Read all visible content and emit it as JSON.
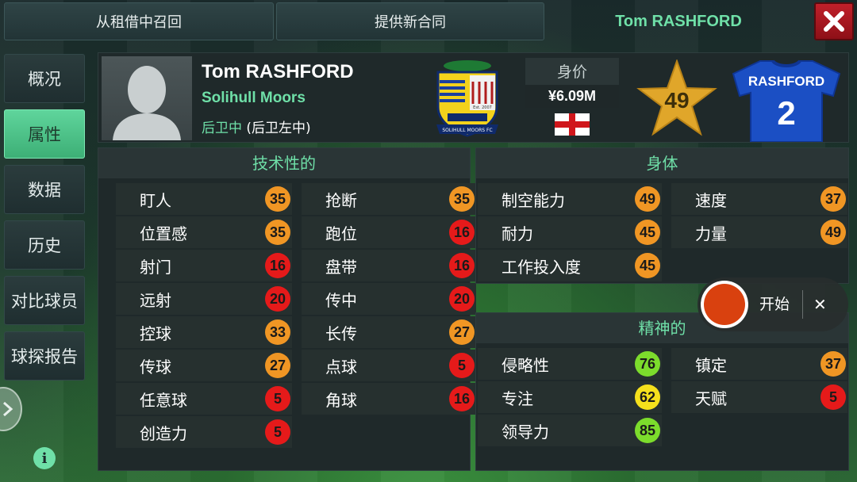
{
  "top": {
    "recall_loan": "从租借中召回",
    "offer_contract": "提供新合同",
    "title": "Tom RASHFORD",
    "close_label": "✕"
  },
  "sidebar": {
    "items": [
      {
        "label": "概况"
      },
      {
        "label": "属性"
      },
      {
        "label": "数据"
      },
      {
        "label": "历史"
      },
      {
        "label": "对比球员"
      },
      {
        "label": "球探报告"
      }
    ],
    "active_index": 1,
    "info_icon": "i"
  },
  "player": {
    "name": "Tom RASHFORD",
    "club": "Solihull Moors",
    "position_primary": "后卫中",
    "position_secondary": "(后卫左中)",
    "value_label": "身价",
    "value": "¥6.09M",
    "rating": "49",
    "shirt_name": "RASHFORD",
    "shirt_number": "2",
    "crest_name": "SOLIHULL MOORS FC",
    "crest_est": "Est. 2007"
  },
  "technical": {
    "title": "技术性的",
    "left": [
      {
        "label": "盯人",
        "value": "35",
        "level": "orange"
      },
      {
        "label": "位置感",
        "value": "35",
        "level": "orange"
      },
      {
        "label": "射门",
        "value": "16",
        "level": "red"
      },
      {
        "label": "远射",
        "value": "20",
        "level": "red"
      },
      {
        "label": "控球",
        "value": "33",
        "level": "orange"
      },
      {
        "label": "传球",
        "value": "27",
        "level": "orange"
      },
      {
        "label": "任意球",
        "value": "5",
        "level": "red"
      },
      {
        "label": "创造力",
        "value": "5",
        "level": "red"
      }
    ],
    "right": [
      {
        "label": "抢断",
        "value": "35",
        "level": "orange"
      },
      {
        "label": "跑位",
        "value": "16",
        "level": "red"
      },
      {
        "label": "盘带",
        "value": "16",
        "level": "red"
      },
      {
        "label": "传中",
        "value": "20",
        "level": "red"
      },
      {
        "label": "长传",
        "value": "27",
        "level": "orange"
      },
      {
        "label": "点球",
        "value": "5",
        "level": "red"
      },
      {
        "label": "角球",
        "value": "16",
        "level": "red"
      }
    ]
  },
  "physical": {
    "title": "身体",
    "left": [
      {
        "label": "制空能力",
        "value": "49",
        "level": "orange"
      },
      {
        "label": "耐力",
        "value": "45",
        "level": "orange"
      },
      {
        "label": "工作投入度",
        "value": "45",
        "level": "orange"
      }
    ],
    "right": [
      {
        "label": "速度",
        "value": "37",
        "level": "orange"
      },
      {
        "label": "力量",
        "value": "49",
        "level": "orange"
      }
    ]
  },
  "mental": {
    "title": "精神的",
    "left": [
      {
        "label": "侵略性",
        "value": "76",
        "level": "green"
      },
      {
        "label": "专注",
        "value": "62",
        "level": "yellow"
      },
      {
        "label": "领导力",
        "value": "85",
        "level": "green"
      }
    ],
    "right": [
      {
        "label": "镇定",
        "value": "37",
        "level": "orange"
      },
      {
        "label": "天赋",
        "value": "5",
        "level": "red"
      }
    ]
  },
  "recorder": {
    "start_label": "开始",
    "close_label": "✕"
  },
  "colors": {
    "accent": "#6fe0a8",
    "red": "#e51a1a",
    "orange": "#f09624",
    "yellow": "#f5e01c",
    "green": "#7cdc2c"
  }
}
